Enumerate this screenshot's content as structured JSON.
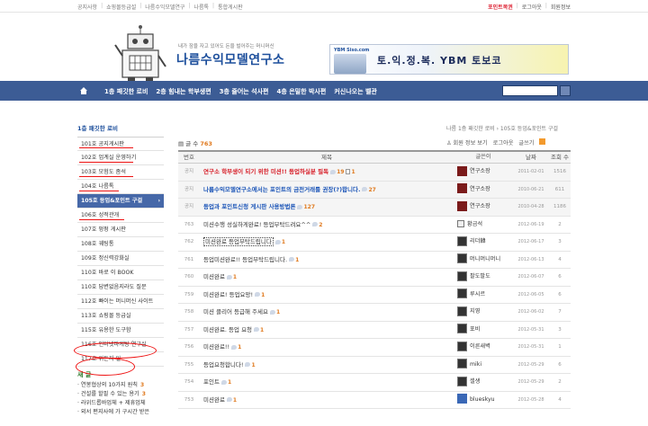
{
  "topbar": {
    "links": [
      "공지사항",
      "쇼핑몰등급설",
      "나름수익모델연구",
      "나름톡",
      "통합게시판"
    ],
    "right": {
      "points": "포인트복권",
      "logout": "로그아웃",
      "member": "회원정보"
    }
  },
  "header": {
    "slogan": "내가 잠을 자고 있어도 돈을 벌어주는 머니머신",
    "title": "나름수익모델연구소",
    "ad": {
      "logo": "YBM Siso.com",
      "text": "토.익.정.복. YBM 토보코"
    }
  },
  "nav": {
    "items": [
      "1층 패깃한 로비",
      "2층 힘내는 학부생편",
      "3층 즐어는 석사편",
      "4층 은밀한 박사편",
      "커신나오는 벨관"
    ]
  },
  "sidebar": {
    "title": "1층 패깃한 로비",
    "items": [
      "101호 공지게시판",
      "102호 업계실 운영하기",
      "103호 모험도 좀석",
      "104호 나름톡",
      "105호 등업&포인트 구걸",
      "106호 성적관개",
      "107호 펑펑 게시판",
      "108호 궤팅통",
      "109호 정신력강화실",
      "110호 바로 이 BOOK",
      "110호 답변없음지라도 질문",
      "112호 빠이는 머니머신 사이트",
      "113호 쇼핑몰 등급실",
      "115호 유용한 도구함",
      "116호 인터넷마케팅 연구실",
      "117호 위돈지 일"
    ],
    "new_title": "새 글",
    "new_items": [
      {
        "text": "· 연봉협상의 10가지 원칙",
        "count": "3"
      },
      {
        "text": "· 건설를 할필 수 있는 용기",
        "count": "3"
      },
      {
        "text": "· 라위드롭바업체 + 제휴업체",
        "count": ""
      },
      {
        "text": "· 외서 편지사에 가 구시간 받은",
        "count": ""
      }
    ]
  },
  "board": {
    "breadcrumb": "나름 1층 패깃한 로비 › 105호 등업&포인트 구걸",
    "total_label": "글 수",
    "total": "763",
    "tools": {
      "member_view": "회원 정보 보기",
      "login": "로그아웃",
      "rss": "글쓰기"
    },
    "headers": {
      "no": "번호",
      "title": "제목",
      "author": "글쓴이",
      "date": "날짜",
      "views": "조회 수"
    },
    "rows": [
      {
        "no": "공지",
        "title": "연구소 학부생이 되기 위한 미션!! 등업하실분 필독",
        "comments": "19",
        "att": "1",
        "author": "연구소장",
        "date": "2011-02-01",
        "views": "1516",
        "style": "red",
        "avatar": "logo"
      },
      {
        "no": "공지",
        "title": "나름수익모델연구소에서는 포인트의 금전거래를 권장(?)합니다.",
        "comments": "27",
        "att": "",
        "author": "연구소장",
        "date": "2010-06-21",
        "views": "611",
        "style": "blue",
        "avatar": "logo"
      },
      {
        "no": "공지",
        "title": "등업과 포인트신청 게시판 사용방법론",
        "comments": "127",
        "att": "",
        "author": "연구소장",
        "date": "2010-04-28",
        "views": "1186",
        "style": "blue",
        "avatar": "logo"
      },
      {
        "no": "763",
        "title": "미션수행 성실하게완료! 등업부탁드려요^^",
        "comments": "2",
        "att": "",
        "author": "황금석",
        "date": "2012-06-19",
        "views": "2",
        "style": "",
        "avatar": "sm"
      },
      {
        "no": "762",
        "title": "미션완료 등업부탁드립니다",
        "comments": "1",
        "att": "",
        "author": "리더韓",
        "date": "2012-06-17",
        "views": "3",
        "style": "boxed",
        "avatar": "dark"
      },
      {
        "no": "761",
        "title": "등업미션완료!! 등업부탁드립니다.",
        "comments": "1",
        "att": "",
        "author": "머니머니머니",
        "date": "2012-06-13",
        "views": "4",
        "style": "",
        "avatar": "dark"
      },
      {
        "no": "760",
        "title": "미션완료",
        "comments": "1",
        "att": "",
        "author": "팔도팔도",
        "date": "2012-06-07",
        "views": "6",
        "style": "",
        "avatar": "dark"
      },
      {
        "no": "759",
        "title": "미션완료! 등업요망!",
        "comments": "1",
        "att": "",
        "author": "루시르",
        "date": "2012-06-05",
        "views": "6",
        "style": "",
        "avatar": "dark"
      },
      {
        "no": "758",
        "title": "미션 클리어 등급해 주세요",
        "comments": "1",
        "att": "",
        "author": "지영",
        "date": "2012-06-02",
        "views": "7",
        "style": "",
        "avatar": "dark"
      },
      {
        "no": "757",
        "title": "미션완료. 등업 요청",
        "comments": "1",
        "att": "",
        "author": "포비",
        "date": "2012-05-31",
        "views": "3",
        "style": "",
        "avatar": "dark"
      },
      {
        "no": "756",
        "title": "미션완료!!",
        "comments": "1",
        "att": "",
        "author": "이른새벽",
        "date": "2012-05-31",
        "views": "1",
        "style": "",
        "avatar": "dark"
      },
      {
        "no": "755",
        "title": "등업요청합니다!",
        "comments": "1",
        "att": "",
        "author": "miki",
        "date": "2012-05-29",
        "views": "6",
        "style": "",
        "avatar": "dark"
      },
      {
        "no": "754",
        "title": "포인트",
        "comments": "1",
        "att": "",
        "author": "셀생",
        "date": "2012-05-29",
        "views": "2",
        "style": "",
        "avatar": "dark"
      },
      {
        "no": "753",
        "title": "미션완료",
        "comments": "1",
        "att": "",
        "author": "blueskyu",
        "date": "2012-05-28",
        "views": "4",
        "style": "",
        "avatar": "blue"
      }
    ]
  },
  "colors": {
    "nav": "#3c5c95",
    "accent": "#e07a1f",
    "notice_red": "#d7202a",
    "notice_blue": "#1d56b8",
    "annotation": "#e11111"
  }
}
